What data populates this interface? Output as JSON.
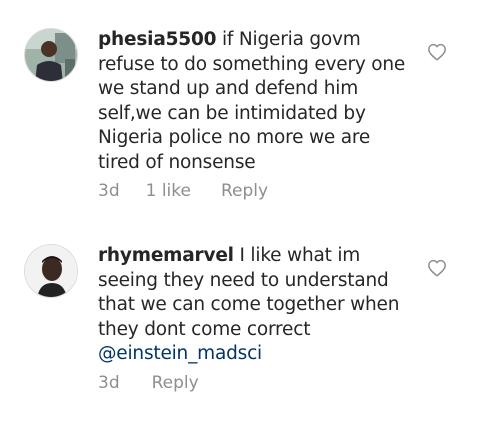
{
  "comments": [
    {
      "username": "phesia5500",
      "text": "if Nigeria govm refuse to do something every one we stand up and defend him self,we can be intimidated by Nigeria police no more we are tired of nonsense",
      "mention": "",
      "time": "3d",
      "likes": "1 like",
      "reply_label": "Reply",
      "avatar_icon": "user-photo-avatar",
      "like_icon": "heart-outline-icon"
    },
    {
      "username": "rhymemarvel",
      "text": "I like what im seeing they need to understand that we can come together when they dont come correct",
      "mention": "@einstein_madsci",
      "time": "3d",
      "likes": "",
      "reply_label": "Reply",
      "avatar_icon": "user-photo-avatar",
      "like_icon": "heart-outline-icon"
    }
  ],
  "colors": {
    "text": "#262626",
    "meta": "#8e8e8e",
    "mention": "#003569",
    "background": "#ffffff"
  }
}
